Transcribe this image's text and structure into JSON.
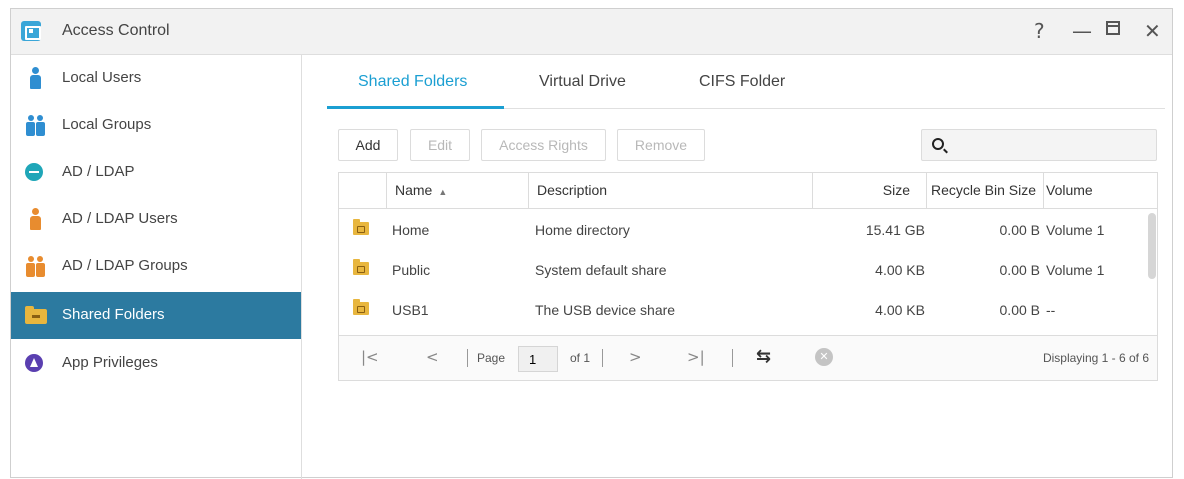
{
  "window": {
    "title": "Access Control",
    "controls": {
      "help": "?",
      "minimize": "—",
      "close": "✕"
    }
  },
  "sidebar": {
    "items": [
      {
        "label": "Local Users",
        "icon": "user-icon",
        "active": false
      },
      {
        "label": "Local Groups",
        "icon": "group-icon",
        "active": false
      },
      {
        "label": "AD / LDAP",
        "icon": "key-icon",
        "active": false
      },
      {
        "label": "AD / LDAP Users",
        "icon": "user-icon",
        "active": false
      },
      {
        "label": "AD / LDAP Groups",
        "icon": "group-icon",
        "active": false
      },
      {
        "label": "Shared Folders",
        "icon": "folder-icon",
        "active": true
      },
      {
        "label": "App Privileges",
        "icon": "privileges-icon",
        "active": false
      }
    ]
  },
  "tabs": [
    {
      "label": "Shared Folders",
      "active": true
    },
    {
      "label": "Virtual Drive",
      "active": false
    },
    {
      "label": "CIFS Folder",
      "active": false
    }
  ],
  "toolbar": {
    "add": "Add",
    "edit": "Edit",
    "access_rights": "Access Rights",
    "remove": "Remove",
    "search_placeholder": ""
  },
  "table": {
    "columns": {
      "name": "Name",
      "description": "Description",
      "size": "Size",
      "recycle_bin_size": "Recycle Bin Size",
      "volume": "Volume"
    },
    "sort_indicator": "▲",
    "rows": [
      {
        "name": "Home",
        "description": "Home directory",
        "size": "15.41 GB",
        "recycle": "0.00 B",
        "volume": "Volume 1"
      },
      {
        "name": "Public",
        "description": "System default share",
        "size": "4.00 KB",
        "recycle": "0.00 B",
        "volume": "Volume 1"
      },
      {
        "name": "USB1",
        "description": "The USB device share",
        "size": "4.00 KB",
        "recycle": "0.00 B",
        "volume": "--"
      }
    ]
  },
  "pager": {
    "first": "|<",
    "prev": "<",
    "page_label": "Page",
    "page_value": "1",
    "of_label": "of 1",
    "next": ">",
    "last": ">|",
    "refresh": "⇆",
    "clear": "✕",
    "displaying": "Displaying 1 - 6 of 6"
  },
  "colors": {
    "accent": "#1b9fd2",
    "sidebar_active": "#2c7aa0",
    "folder": "#e8b63e"
  }
}
